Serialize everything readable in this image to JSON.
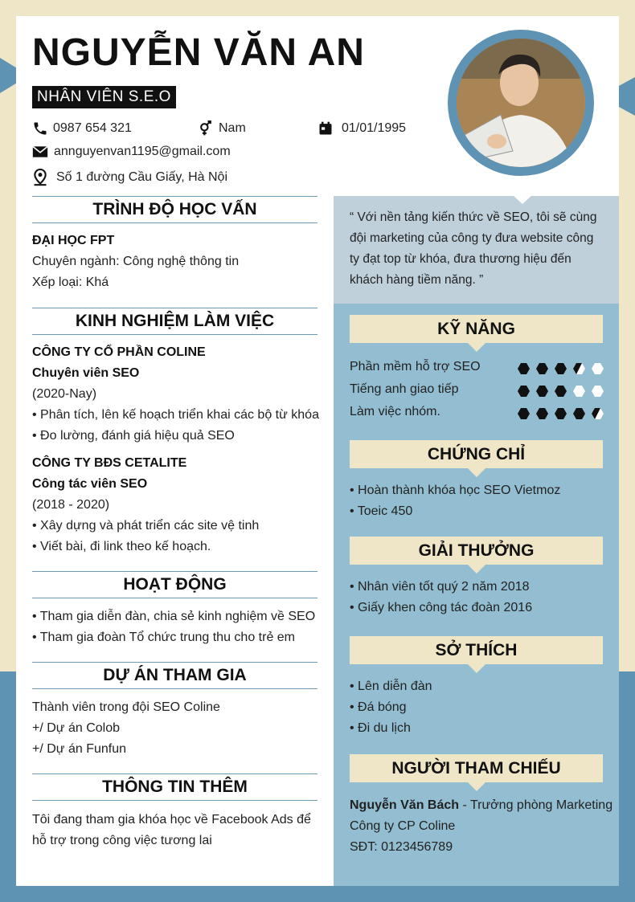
{
  "name": "NGUYỄN VĂN AN",
  "job_title": "NHÂN VIÊN S.E.O",
  "contact": {
    "phone": "0987 654 321",
    "gender": "Nam",
    "dob": "01/01/1995",
    "email": "annguyenvan1195@gmail.com",
    "address": "Số 1 đường Cầu Giấy, Hà Nội"
  },
  "education": {
    "heading": "TRÌNH ĐỘ HỌC VẤN",
    "school": "ĐẠI HỌC FPT",
    "major": "Chuyên ngành: Công nghệ thông tin",
    "grade": "Xếp loại: Khá"
  },
  "experience": {
    "heading": "KINH NGHIỆM LÀM VIỆC",
    "jobs": [
      {
        "company": "CÔNG TY CỔ PHẦN COLINE",
        "role": "Chuyên viên SEO",
        "period": "(2020-Nay)",
        "tasks": [
          "• Phân tích, lên kế hoạch triển khai các bộ từ khóa",
          "• Đo lường, đánh giá hiệu quả SEO"
        ]
      },
      {
        "company": "CÔNG TY BĐS CETALITE",
        "role": "Công tác viên SEO",
        "period": "(2018 - 2020)",
        "tasks": [
          "• Xây dựng và phát triển các site vệ tinh",
          "• Viết bài, đi link theo kế hoạch."
        ]
      }
    ]
  },
  "activities": {
    "heading": "HOẠT ĐỘNG",
    "items": [
      "• Tham gia diễn đàn, chia sẻ kinh nghiệm về SEO",
      "• Tham gia đoàn Tổ chức trung thu cho trẻ em"
    ]
  },
  "projects": {
    "heading": "DỰ ÁN THAM GIA",
    "items": [
      "Thành viên trong đội SEO Coline",
      "+/ Dự án Colob",
      "+/ Dự án Funfun"
    ]
  },
  "more_info": {
    "heading": "THÔNG TIN THÊM",
    "lines": [
      "Tôi đang tham gia khóa học về Facebook  Ads để",
      "hỗ trợ trong công việc tương lai"
    ]
  },
  "quote": {
    "lines": [
      "“ Với nền tảng kiến thức về SEO, tôi sẽ cùng",
      "đội marketing của công ty đưa website công",
      "ty đạt top từ khóa, đưa thương hiệu đến",
      "khách hàng tiềm năng. ”"
    ]
  },
  "skills": {
    "heading": "KỸ NĂNG",
    "items": [
      {
        "label": "Phần mềm hỗ trợ SEO",
        "level": 3.5
      },
      {
        "label": "Tiếng anh giao tiếp",
        "level": 3
      },
      {
        "label": "Làm việc nhóm.",
        "level": 4.5
      }
    ],
    "max": 5
  },
  "certificates": {
    "heading": "CHỨNG CHỈ",
    "items": [
      "• Hoàn thành khóa học SEO Vietmoz",
      "• Toeic 450"
    ]
  },
  "awards": {
    "heading": "GIẢI THƯỞNG",
    "items": [
      "• Nhân viên  tốt quý 2 năm 2018",
      "• Giấy khen công tác đoàn 2016"
    ]
  },
  "hobbies": {
    "heading": "SỞ THÍCH",
    "items": [
      "• Lên diễn đàn",
      "• Đá bóng",
      "• Đi du lịch"
    ]
  },
  "reference": {
    "heading": "NGƯỜI THAM CHIẾU",
    "person": "Nguyễn Văn Bách",
    "position": " - Trưởng phòng Marketing",
    "company": "Công ty CP Coline",
    "phone": "SĐT: 0123456789"
  },
  "colors": {
    "accent_blue": "#5e93b3",
    "panel_blue": "#93bdd0",
    "panel_light": "#c0d0da",
    "cream": "#efe6c8"
  }
}
